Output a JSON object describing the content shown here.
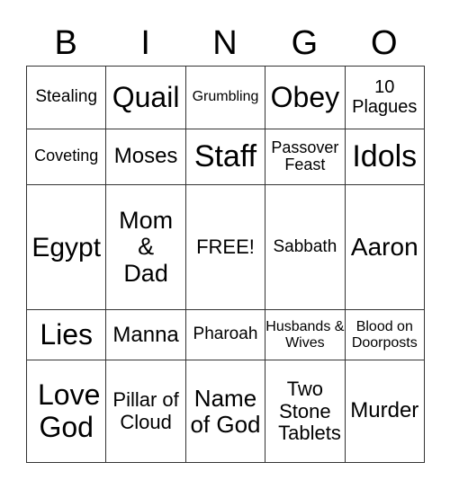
{
  "header": [
    "B",
    "I",
    "N",
    "G",
    "O"
  ],
  "rows": [
    [
      "Stealing",
      "Quail",
      "Grumbling",
      "Obey",
      "10 Plagues"
    ],
    [
      "Coveting",
      "Moses",
      "Staff",
      "Passover Feast",
      "Idols"
    ],
    [
      "Egypt",
      "Mom & Dad",
      "FREE!",
      "Sabbath",
      "Aaron"
    ],
    [
      "Lies",
      "Manna",
      "Pharoah",
      "Husbands & Wives",
      "Blood on Doorposts"
    ],
    [
      "Love God",
      "Pillar of Cloud",
      "Name of God",
      "Two Stone Tablets",
      "Murder"
    ]
  ]
}
